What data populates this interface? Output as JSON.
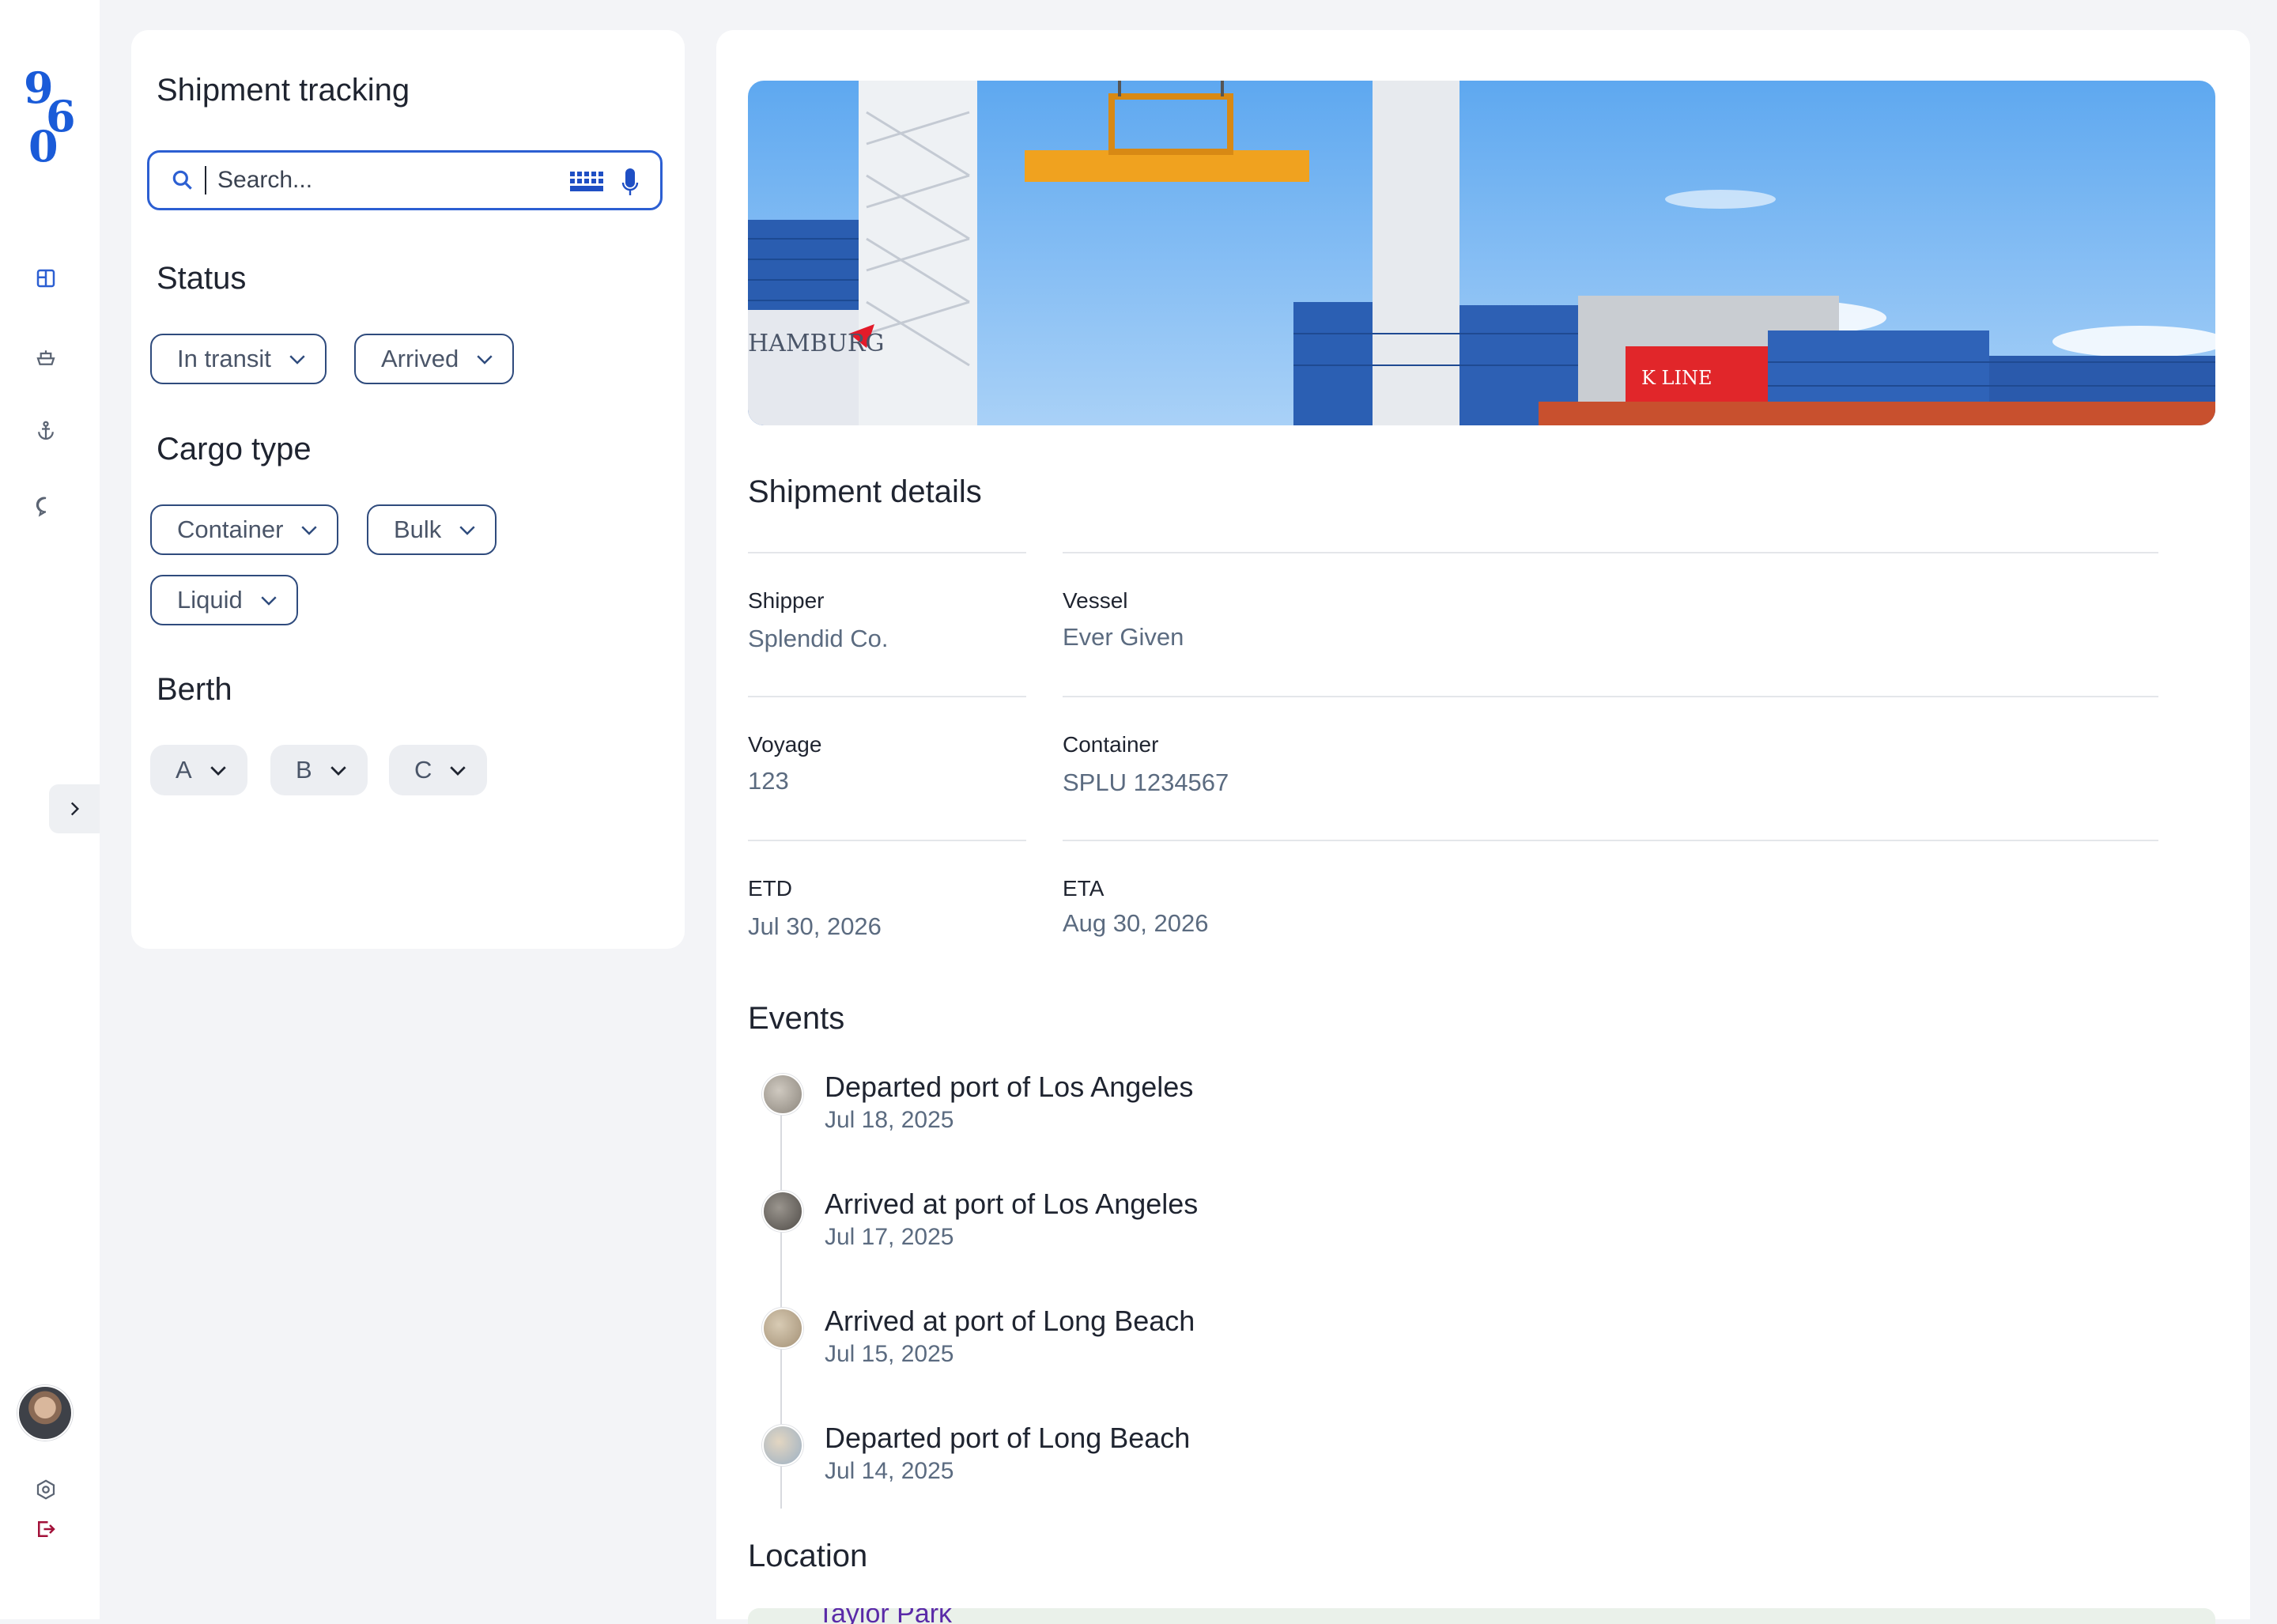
{
  "rail": {
    "logo_text": "960",
    "nav": [
      {
        "name": "dashboard-icon"
      },
      {
        "name": "ship-icon"
      },
      {
        "name": "anchor-icon"
      },
      {
        "name": "chat-icon"
      }
    ],
    "bottom": [
      {
        "name": "settings-icon"
      },
      {
        "name": "logout-icon"
      }
    ]
  },
  "filters": {
    "title": "Shipment tracking",
    "search_placeholder": "Search...",
    "status": {
      "label": "Status",
      "chips": [
        "In transit",
        "Arrived"
      ]
    },
    "cargo": {
      "label": "Cargo type",
      "chips": [
        "Container",
        "Bulk",
        "Liquid"
      ]
    },
    "berth": {
      "label": "Berth",
      "chips": [
        "A",
        "B",
        "C"
      ]
    }
  },
  "details": {
    "title": "Shipment details",
    "shipper": {
      "label": "Shipper",
      "value": "Splendid Co."
    },
    "vessel": {
      "label": "Vessel",
      "value": "Ever Given"
    },
    "voyage": {
      "label": "Voyage",
      "value": "123"
    },
    "container": {
      "label": "Container",
      "value": "SPLU 1234567"
    },
    "etd": {
      "label": "ETD",
      "value": "Jul 30, 2026"
    },
    "eta": {
      "label": "ETA",
      "value": "Aug 30, 2026"
    }
  },
  "events": {
    "title": "Events",
    "items": [
      {
        "title": "Departed port of Los Angeles",
        "date": "Jul 18, 2025"
      },
      {
        "title": "Arrived at port of Los Angeles",
        "date": "Jul 17, 2025"
      },
      {
        "title": "Arrived at port of Long Beach",
        "date": "Jul 15, 2025"
      },
      {
        "title": "Departed port of Long Beach",
        "date": "Jul 14, 2025"
      }
    ]
  },
  "location": {
    "title": "Location",
    "map_label": "Taylor Park"
  },
  "hero": {
    "signs": [
      "HAMBURG",
      "K LINE"
    ]
  },
  "colors": {
    "accent": "#2c5fd2",
    "chip_border": "#2f4b7d",
    "muted_text": "#5b6b80",
    "logout": "#a3123a"
  }
}
